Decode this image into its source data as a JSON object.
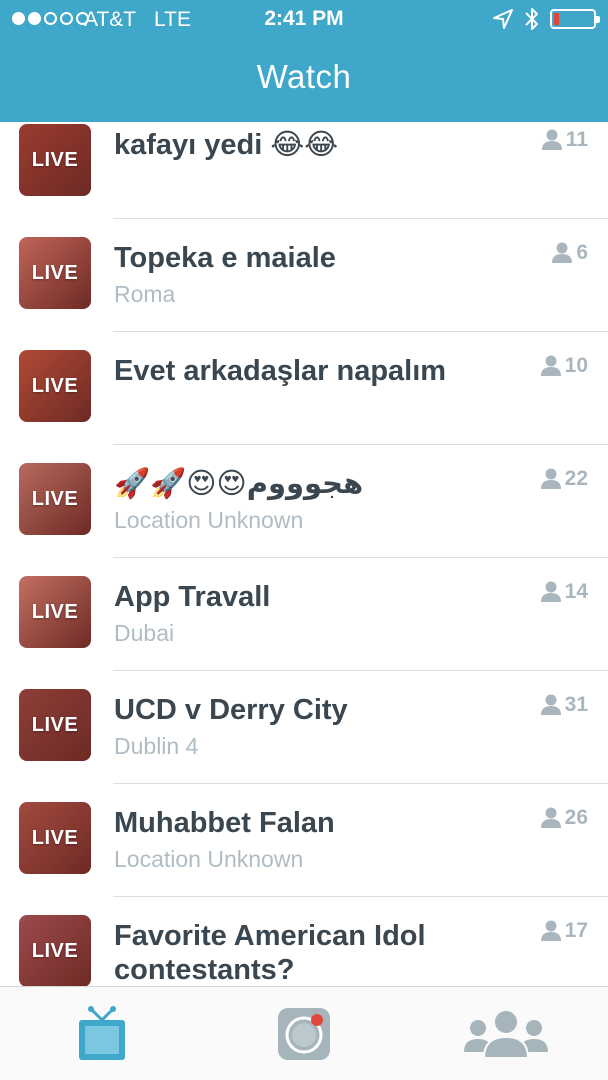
{
  "status_bar": {
    "carrier": "AT&T",
    "network": "LTE",
    "time": "2:41 PM",
    "signal_bars_full": 2,
    "signal_bars_total": 5,
    "battery_level": 0.1
  },
  "nav": {
    "title": "Watch"
  },
  "broadcasts": [
    {
      "title": "kafayı yedi 😂😂",
      "subtitle": "",
      "viewers": "11",
      "badge": "LIVE",
      "thumb_color": "#9a3c30"
    },
    {
      "title": "Topeka e maiale",
      "subtitle": "Roma",
      "viewers": "6",
      "badge": "LIVE",
      "thumb_color": "#c0655a"
    },
    {
      "title": "Evet arkadaşlar napalım",
      "subtitle": "",
      "viewers": "10",
      "badge": "LIVE",
      "thumb_color": "#b04a36"
    },
    {
      "title": "🚀🚀😍😍هجوووم",
      "subtitle": "Location Unknown",
      "viewers": "22",
      "badge": "LIVE",
      "thumb_color": "#b86a5e"
    },
    {
      "title": "App Travall",
      "subtitle": "Dubai",
      "viewers": "14",
      "badge": "LIVE",
      "thumb_color": "#c47063"
    },
    {
      "title": "UCD v Derry City",
      "subtitle": "Dublin 4",
      "viewers": "31",
      "badge": "LIVE",
      "thumb_color": "#8e3e38"
    },
    {
      "title": "Muhabbet Falan",
      "subtitle": "Location Unknown",
      "viewers": "26",
      "badge": "LIVE",
      "thumb_color": "#a24a40"
    },
    {
      "title": "Favorite American Idol contestants?",
      "subtitle": "",
      "viewers": "17",
      "badge": "LIVE",
      "thumb_color": "#9e4a4e"
    }
  ],
  "tabbar": {
    "tabs": [
      {
        "name": "watch",
        "icon": "tv-icon",
        "active": true
      },
      {
        "name": "broadcast",
        "icon": "camera-icon",
        "active": false
      },
      {
        "name": "people",
        "icon": "people-icon",
        "active": false
      }
    ],
    "colors": {
      "active": "#3fa7c9",
      "inactive": "#a6b4bc"
    }
  }
}
